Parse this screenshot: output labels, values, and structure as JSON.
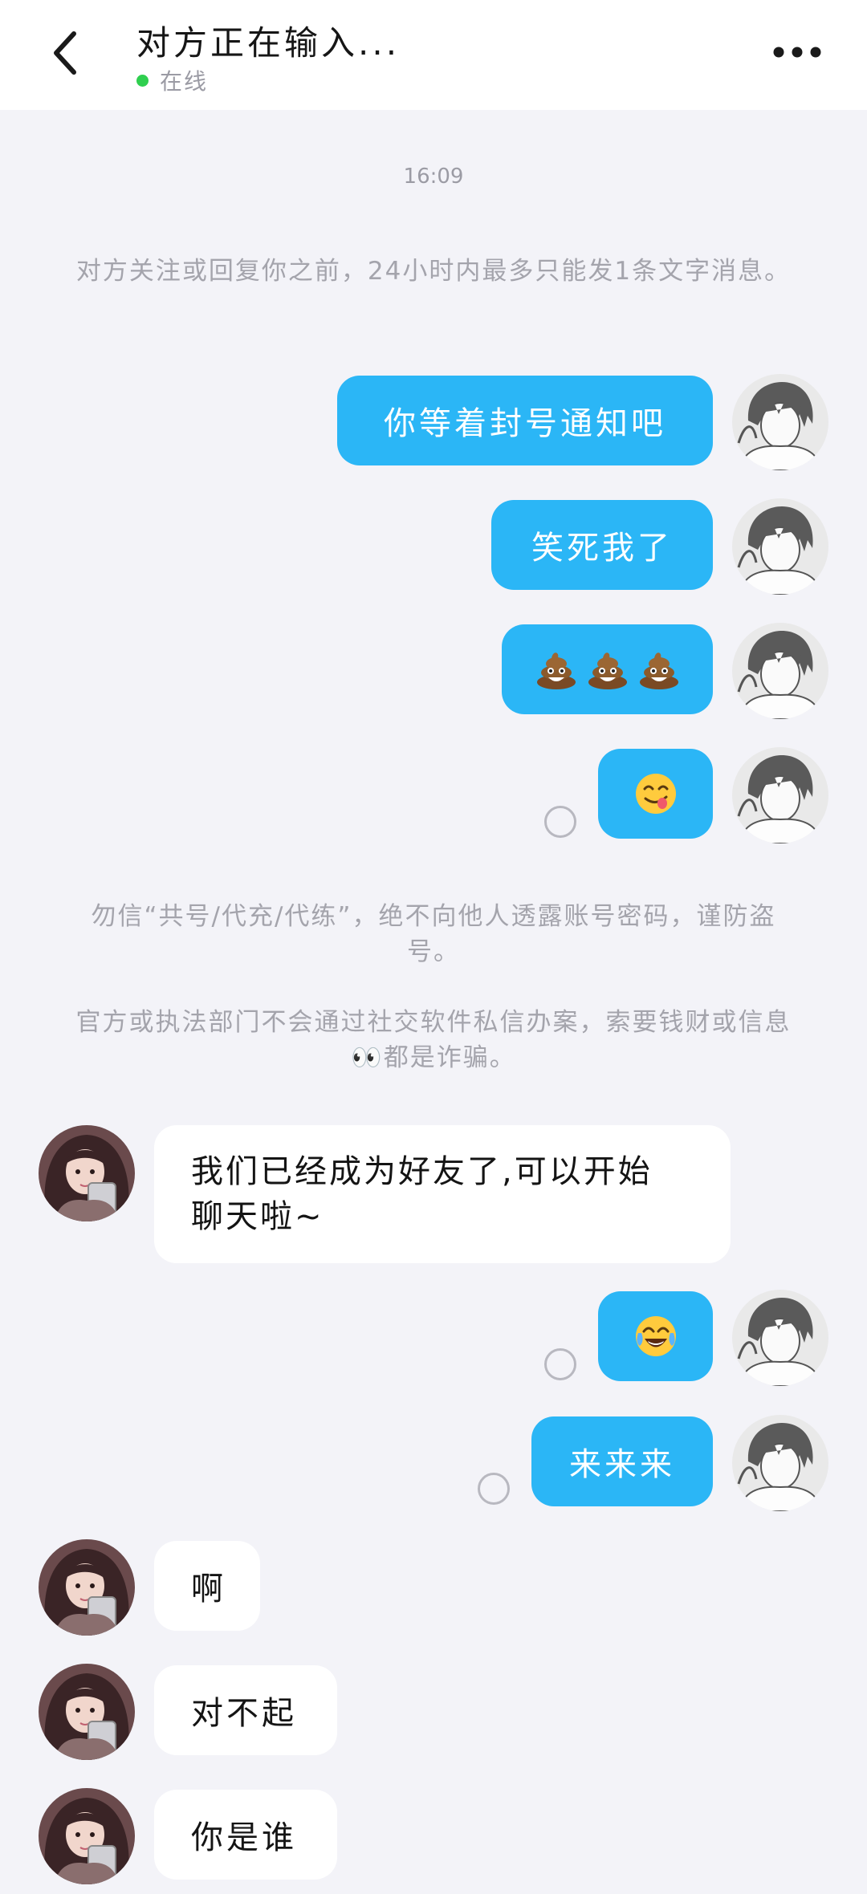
{
  "header": {
    "title": "对方正在输入...",
    "status": "在线"
  },
  "colors": {
    "outgoing_bubble": "#2bb6f6",
    "incoming_bubble": "#ffffff",
    "online_dot": "#2fcf4f",
    "background": "#f3f3f8"
  },
  "chat": {
    "timestamp": "16:09",
    "notice_limit": "对方关注或回复你之前，24小时内最多只能发1条文字消息。",
    "notice_security_1": "勿信“共号/代充/代练”，绝不向他人透露账号密码，谨防盗号。",
    "notice_security_2": "官方或执法部门不会通过社交软件私信办案，索要钱财或信息👀都是诈骗。",
    "messages": [
      {
        "sender": "me",
        "text": "你等着封号通知吧"
      },
      {
        "sender": "me",
        "text": "笑死我了"
      },
      {
        "sender": "me",
        "emoji": [
          "pile-of-poo-emoji",
          "pile-of-poo-emoji",
          "pile-of-poo-emoji"
        ]
      },
      {
        "sender": "me",
        "emoji": [
          "face-savoring-food-emoji"
        ],
        "read_status": "unread"
      },
      {
        "sender": "other",
        "text": "我们已经成为好友了,可以开始聊天啦~"
      },
      {
        "sender": "me",
        "emoji": [
          "face-with-tears-of-joy-emoji"
        ],
        "read_status": "unread"
      },
      {
        "sender": "me",
        "text": "来来来",
        "read_status": "unread"
      },
      {
        "sender": "other",
        "text": "啊"
      },
      {
        "sender": "other",
        "text": "对不起"
      },
      {
        "sender": "other",
        "text": "你是谁"
      }
    ],
    "friend_line_1": "我们已经成为好友了,可以开始",
    "friend_line_2": "聊天啦~"
  }
}
